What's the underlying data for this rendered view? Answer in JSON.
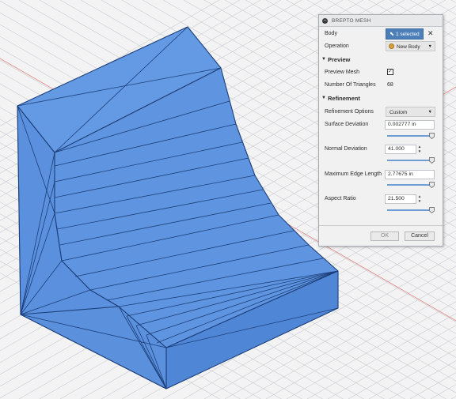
{
  "dialog": {
    "title": "BREPTO MESH",
    "body": {
      "label": "Body",
      "selection": "1 selected"
    },
    "operation": {
      "label": "Operation",
      "value": "New Body"
    },
    "preview_section": {
      "title": "Preview",
      "preview_mesh_label": "Preview Mesh",
      "preview_mesh_checked": true,
      "preview_mesh_check_glyph": "✓",
      "triangles_label": "Number Of Triangles",
      "triangles_value": "68"
    },
    "refinement_section": {
      "title": "Refinement",
      "options_label": "Refinement Options",
      "options_value": "Custom",
      "surface_deviation": {
        "label": "Surface Deviation",
        "value": "0.002777 in"
      },
      "normal_deviation": {
        "label": "Normal Deviation",
        "value": "41.000"
      },
      "max_edge_length": {
        "label": "Maximum Edge Length",
        "value": "2.77675 in"
      },
      "aspect_ratio": {
        "label": "Aspect Ratio",
        "value": "21.500"
      }
    },
    "ok_label": "OK",
    "cancel_label": "Cancel"
  },
  "icons": {
    "dialog": "dialog-circle-icon",
    "cursor": "cursor-arrow-icon",
    "close": "close-icon",
    "new_body": "body-icon",
    "collapse": "triangle-down-icon",
    "dropdown": "chevron-down-icon",
    "spinner": "spinner-arrows-icon",
    "slider_thumb": "slider-thumb-icon"
  },
  "colors": {
    "mesh_fill": "#5d92df",
    "mesh_edge": "#1c3f7a",
    "grid": "#c9ccd0",
    "axis_red": "#e06a6a",
    "selected_button": "#4d7fb8"
  }
}
